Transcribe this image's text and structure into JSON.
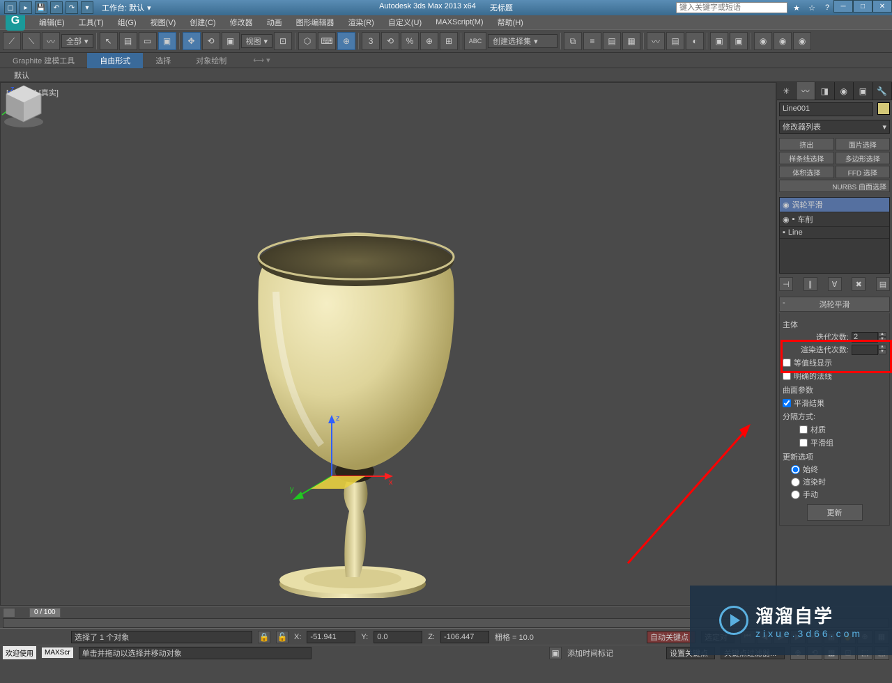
{
  "titlebar": {
    "workspace_label": "工作台: 默认",
    "app_title": "Autodesk 3ds Max  2013 x64",
    "doc_title": "无标题",
    "search_placeholder": "键入关键字或短语"
  },
  "menubar": {
    "items": [
      "编辑(E)",
      "工具(T)",
      "组(G)",
      "视图(V)",
      "创建(C)",
      "修改器",
      "动画",
      "图形编辑器",
      "渲染(R)",
      "自定义(U)",
      "MAXScript(M)",
      "帮助(H)"
    ]
  },
  "toolbar": {
    "filter_all": "全部",
    "view_dropdown": "视图",
    "create_set_placeholder": "创建选择集"
  },
  "ribbon": {
    "tabs": [
      "Graphite 建模工具",
      "自由形式",
      "选择",
      "对象绘制"
    ],
    "active_index": 1,
    "sub_label": "默认"
  },
  "viewport": {
    "label": "[+] [正交] [真实]"
  },
  "right_panel": {
    "object_name": "Line001",
    "modifier_list_label": "修改器列表",
    "mod_buttons": [
      "挤出",
      "面片选择",
      "样条线选择",
      "多边形选择",
      "体积选择",
      "FFD 选择"
    ],
    "nurbs_label": "NURBS 曲面选择",
    "stack": {
      "items": [
        {
          "label": "涡轮平滑",
          "expanded": false,
          "eye": true
        },
        {
          "label": "车削",
          "expanded": true,
          "eye": true
        },
        {
          "label": "Line",
          "expanded": false,
          "eye": false
        }
      ],
      "selected_index": 0
    },
    "rollout_title": "涡轮平滑",
    "main_group": "主体",
    "iterations_label": "迭代次数:",
    "iterations_value": "2",
    "render_iters_label": "渲染迭代次数:",
    "isoline_label": "等值线显示",
    "explicit_normals_label": "明确的法线",
    "surface_params_label": "曲面参数",
    "smooth_result_label": "平滑结果",
    "separate_by_label": "分隔方式:",
    "materials_label": "材质",
    "smoothing_groups_label": "平滑组",
    "update_options_label": "更新选项",
    "always_label": "始终",
    "render_label": "渲染时",
    "manual_label": "手动",
    "update_button": "更新"
  },
  "timeline": {
    "slider_text": "0 / 100"
  },
  "status": {
    "selection_text": "选择了 1 个对象",
    "x_label": "X:",
    "x_value": "-51.941",
    "y_label": "Y:",
    "y_value": "0.0",
    "z_label": "Z:",
    "z_value": "-106.447",
    "grid_label": "栅格 = 10.0",
    "autokey_label": "自动关键点",
    "selected_label": "选定对",
    "welcome_label": "欢迎使用",
    "maxscript_label": "MAXScr",
    "prompt_text": "单击并拖动以选择并移动对象",
    "add_time_tag": "添加时间标记",
    "set_key_label": "设置关键点",
    "key_filter_label": "关键点过滤器..."
  },
  "watermark": {
    "main": "溜溜自学",
    "sub": "zixue.3d66.com"
  }
}
